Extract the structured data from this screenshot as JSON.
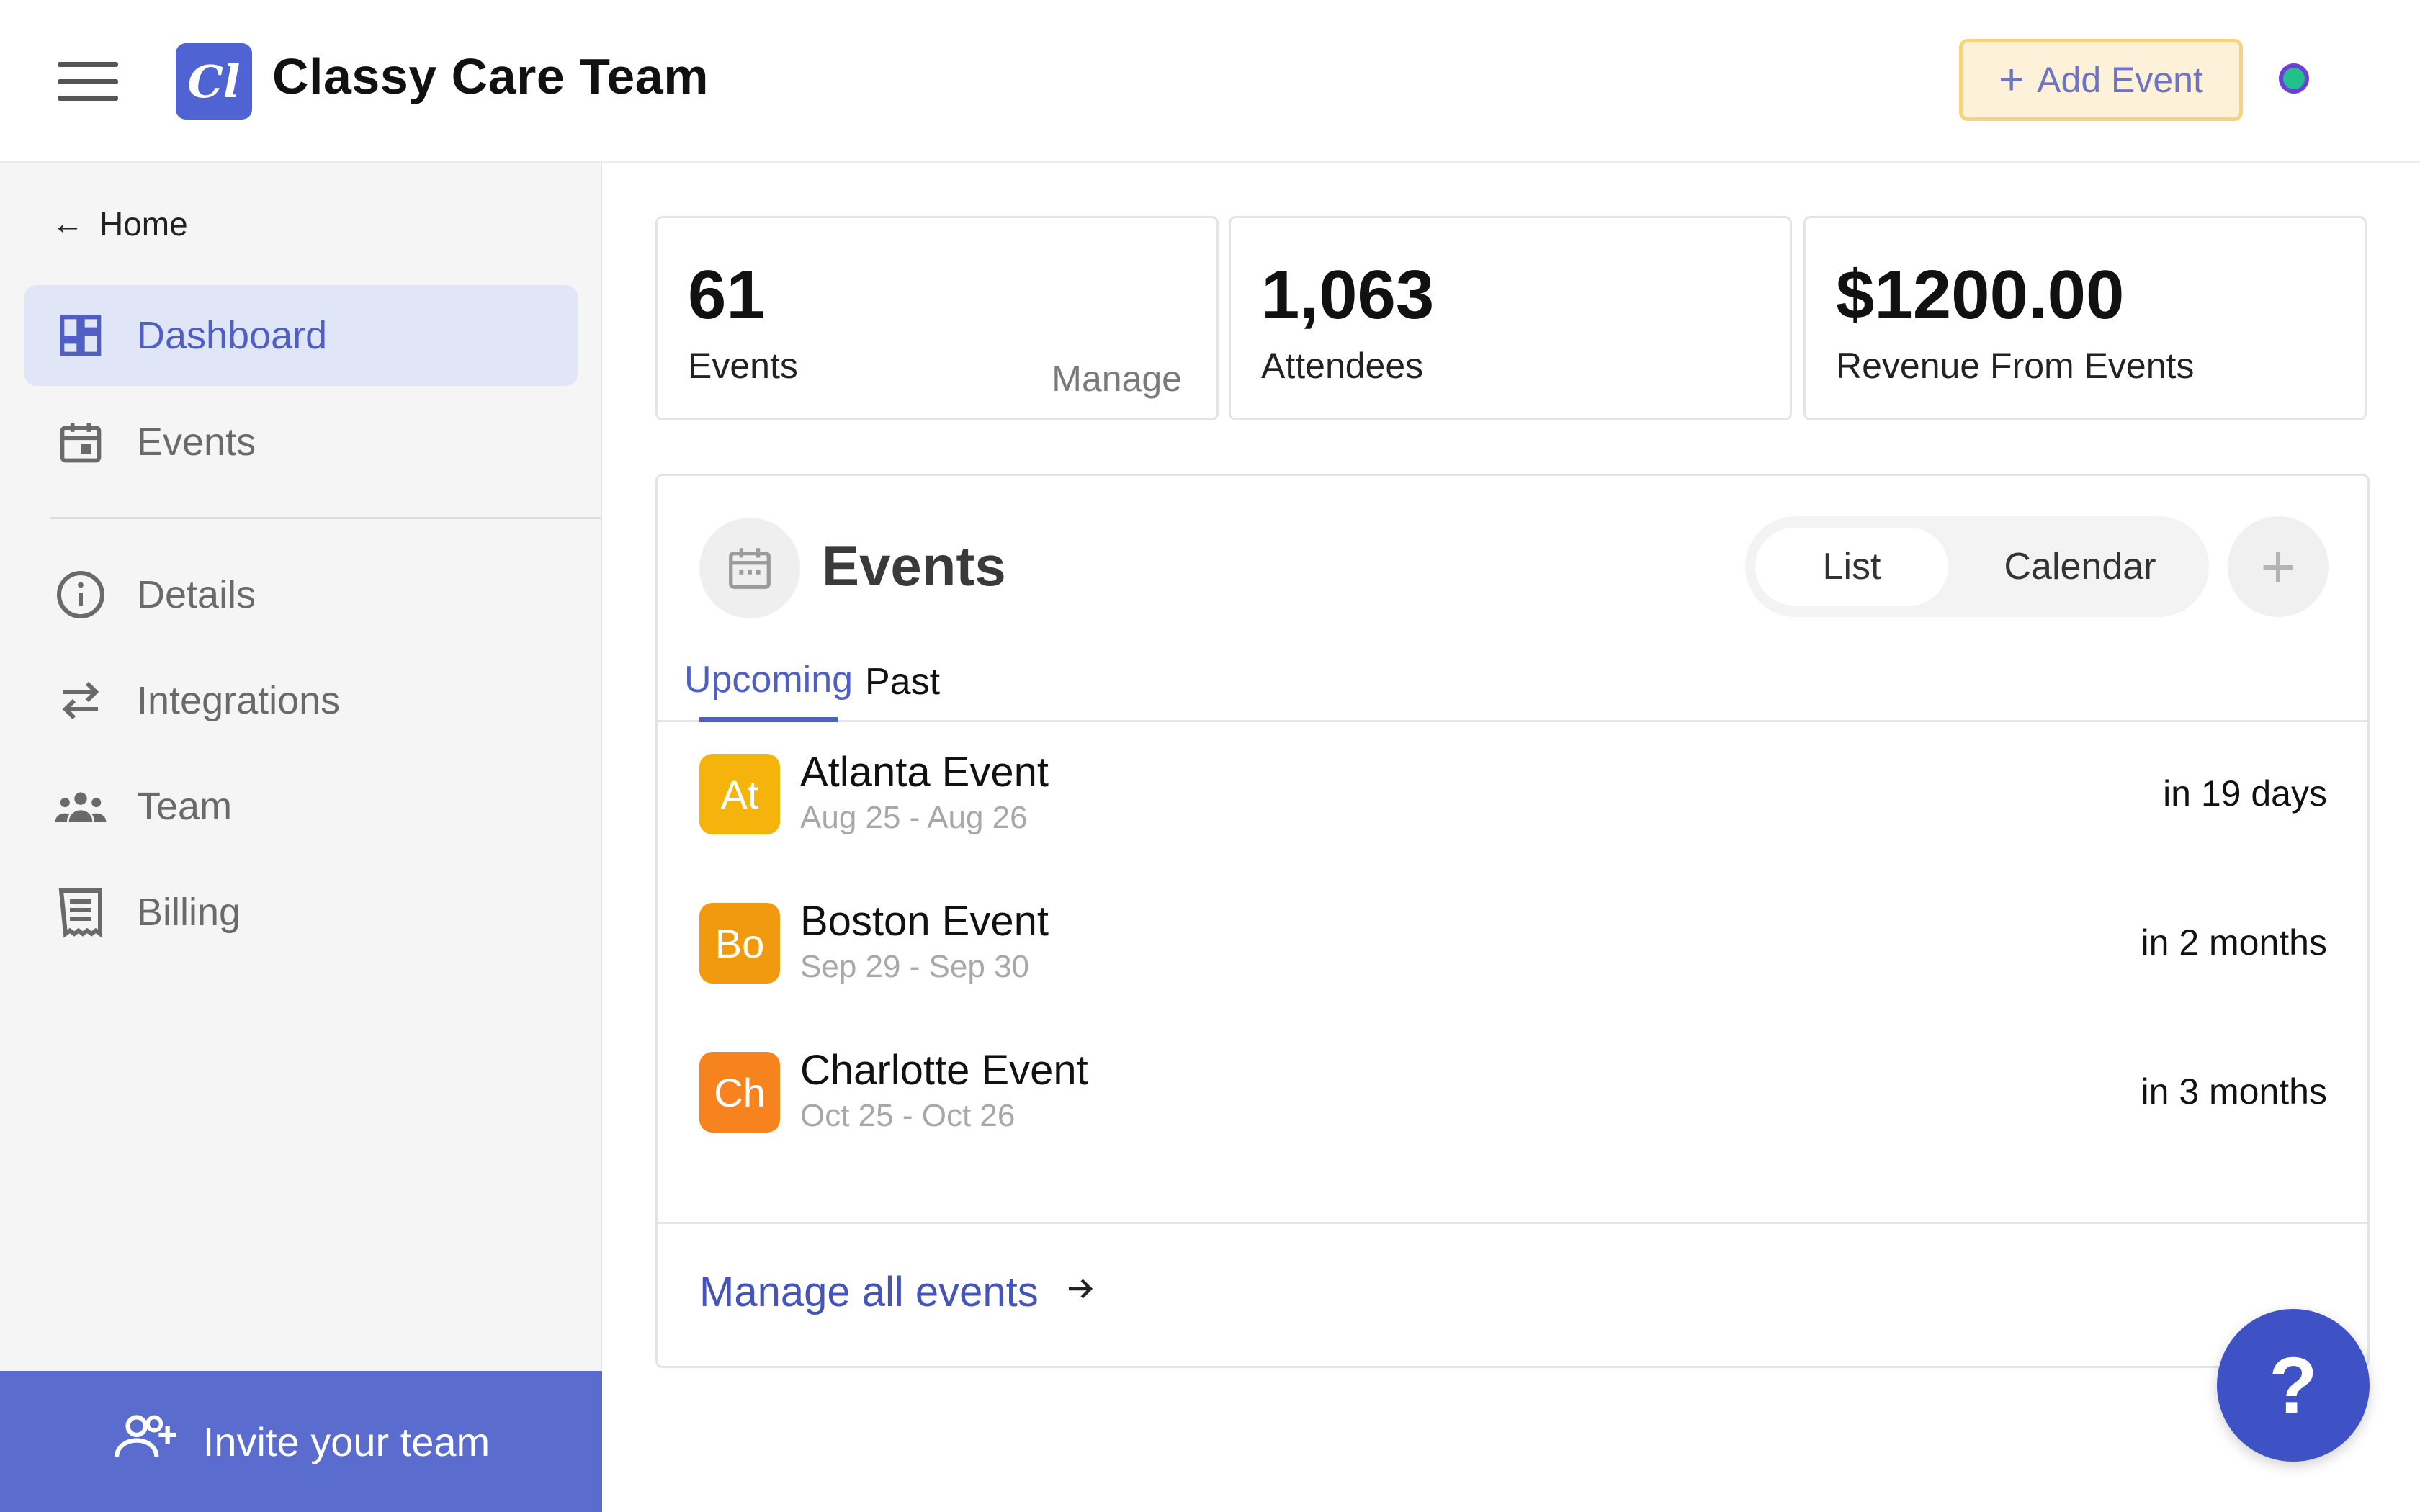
{
  "header": {
    "logo_text": "Cl",
    "org_name": "Classy Care Team",
    "add_event_label": "Add Event",
    "accent": "#4f63d2"
  },
  "sidebar": {
    "home_label": "Home",
    "items": [
      {
        "label": "Dashboard",
        "icon": "dashboard-icon",
        "active": true
      },
      {
        "label": "Events",
        "icon": "calendar-icon"
      },
      {
        "label": "Details",
        "icon": "info-icon"
      },
      {
        "label": "Integrations",
        "icon": "swap-arrows-icon"
      },
      {
        "label": "Team",
        "icon": "team-icon"
      },
      {
        "label": "Billing",
        "icon": "receipt-icon"
      }
    ],
    "invite_label": "Invite your team"
  },
  "stats": [
    {
      "value": "61",
      "caption": "Events",
      "action": "Manage"
    },
    {
      "value": "1,063",
      "caption": "Attendees"
    },
    {
      "value": "$1200.00",
      "caption": "Revenue From Events"
    }
  ],
  "events_panel": {
    "title": "Events",
    "view_options": [
      "List",
      "Calendar"
    ],
    "tabs": [
      "Upcoming",
      "Past"
    ],
    "events": [
      {
        "badge": "At",
        "name": "Atlanta Event",
        "dates": "Aug 25 - Aug 26",
        "when": "in 19 days",
        "color": "#f6b30c"
      },
      {
        "badge": "Bo",
        "name": "Boston Event",
        "dates": "Sep 29 - Sep 30",
        "when": "in 2 months",
        "color": "#f29a0f"
      },
      {
        "badge": "Ch",
        "name": "Charlotte Event",
        "dates": "Oct 25 - Oct 26",
        "when": "in 3 months",
        "color": "#f7831e"
      }
    ],
    "manage_all_label": "Manage all events"
  },
  "help_label": "?"
}
